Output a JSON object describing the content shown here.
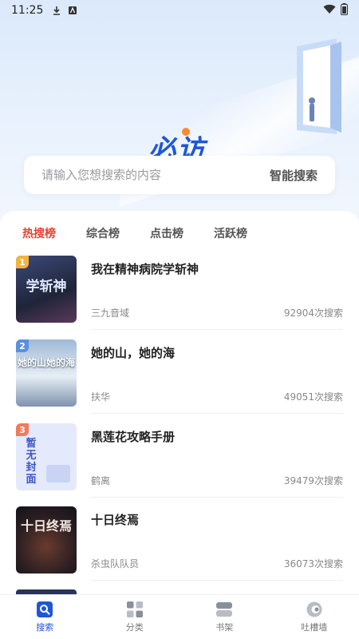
{
  "status_bar": {
    "time": "11:25"
  },
  "header": {
    "logo_text": "必访"
  },
  "search": {
    "placeholder": "请输入您想搜索的内容",
    "button_label": "智能搜索"
  },
  "tabs": [
    {
      "label": "热搜榜",
      "active": true
    },
    {
      "label": "综合榜",
      "active": false
    },
    {
      "label": "点击榜",
      "active": false
    },
    {
      "label": "活跃榜",
      "active": false
    }
  ],
  "books": [
    {
      "rank": "1",
      "title": "我在精神病院学斩神",
      "author": "三九音域",
      "count": "92904次搜索",
      "cover_text": "学斩神",
      "rank_color": "#f2b43a",
      "cover_color": "#2b3350"
    },
    {
      "rank": "2",
      "title": "她的山，她的海",
      "author": "扶华",
      "count": "49051次搜索",
      "cover_text": "她的山她的海",
      "rank_color": "#5b8fe0",
      "cover_color": "#5b7fa6"
    },
    {
      "rank": "3",
      "title": "黑莲花攻略手册",
      "author": "鹤离",
      "count": "39479次搜索",
      "cover_text": "暂无封面",
      "rank_color": "#f07a5c",
      "cover_color": "#e7ecfb"
    },
    {
      "rank": "",
      "title": "十日终焉",
      "author": "杀虫队队员",
      "count": "36073次搜索",
      "cover_text": "十日终焉",
      "rank_color": "",
      "cover_color": "#2a2222"
    }
  ],
  "nav": [
    {
      "label": "搜索",
      "icon": "search-icon",
      "active": true
    },
    {
      "label": "分类",
      "icon": "category-icon",
      "active": false
    },
    {
      "label": "书架",
      "icon": "bookshelf-icon",
      "active": false
    },
    {
      "label": "吐槽墙",
      "icon": "chat-icon",
      "active": false
    }
  ],
  "colors": {
    "accent": "#1f56d6",
    "hot_tab": "#e8402e"
  }
}
